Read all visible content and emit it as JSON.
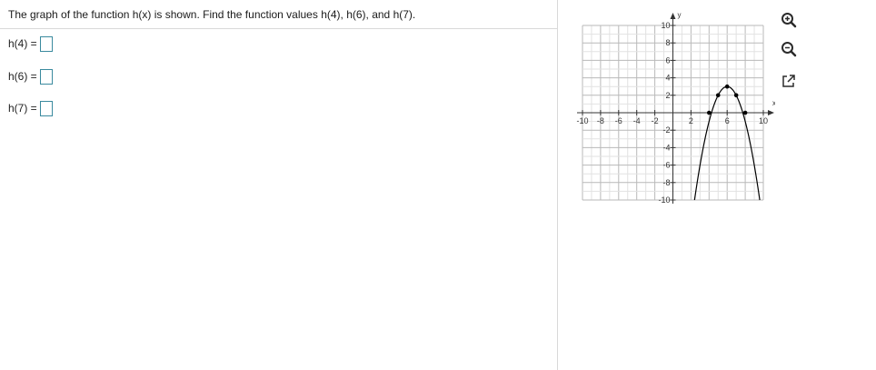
{
  "question": {
    "prompt": "The graph of the function h(x) is shown. Find the function values h(4), h(6), and h(7).",
    "answers": [
      {
        "label": "h(4) =",
        "value": ""
      },
      {
        "label": "h(6) =",
        "value": ""
      },
      {
        "label": "h(7) =",
        "value": ""
      }
    ]
  },
  "toolbar": {
    "icons": [
      "zoom-in-icon",
      "zoom-out-icon",
      "popout-icon"
    ]
  },
  "chart_data": {
    "type": "line",
    "xlabel": "x",
    "ylabel": "y",
    "xlim": [
      -10,
      10
    ],
    "ylim": [
      -10,
      10
    ],
    "grid": true,
    "x_ticks": [
      "-10",
      "-8",
      "-6",
      "-4",
      "-2",
      "2",
      "6",
      "10"
    ],
    "y_ticks": [
      "10",
      "8",
      "6",
      "4",
      "2",
      "-2",
      "-4",
      "-6",
      "-8",
      "-10"
    ],
    "series": [
      {
        "function": "-(x-6)^2+3",
        "points": [
          [
            4,
            0
          ],
          [
            5,
            2
          ],
          [
            6,
            3
          ],
          [
            7,
            2
          ],
          [
            8,
            0
          ]
        ],
        "color": "#000000"
      }
    ]
  }
}
